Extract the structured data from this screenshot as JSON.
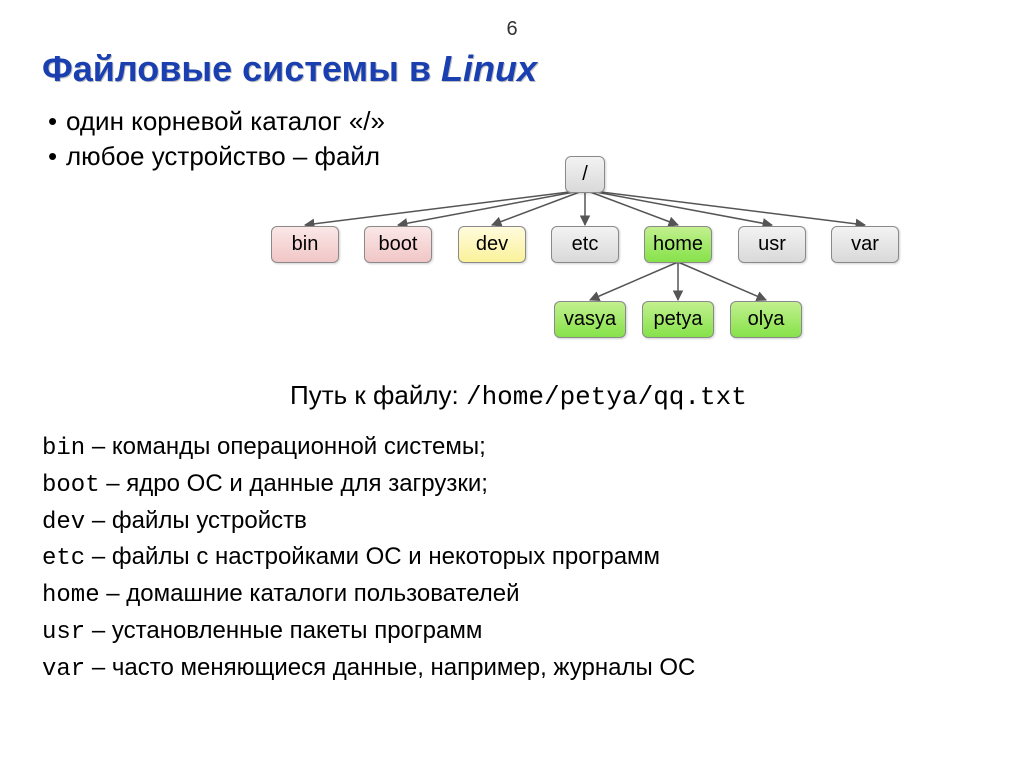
{
  "page_number": "6",
  "title_prefix": "Файловые системы в ",
  "title_italic": "Linux",
  "bullets": [
    "один корневой каталог «/»",
    "любое устройство – файл"
  ],
  "tree": {
    "root": "/",
    "level1": [
      "bin",
      "boot",
      "dev",
      "etc",
      "home",
      "usr",
      "var"
    ],
    "level2": [
      "vasya",
      "petya",
      "olya"
    ]
  },
  "path_label": "Путь к файлу: ",
  "path_value": "/home/petya/qq.txt",
  "defs": [
    {
      "term": "bin",
      "sep": " – ",
      "desc": "команды операционной системы;"
    },
    {
      "term": "boot",
      "sep": " – ",
      "desc": "ядро ОС и данные для загрузки;"
    },
    {
      "term": "dev",
      "sep": " – ",
      "desc": "файлы устройств"
    },
    {
      "term": "etc",
      "sep": " – ",
      "desc": "файлы с настройками ОС и некоторых программ"
    },
    {
      "term": "home",
      "sep": " – ",
      "desc": "домашние каталоги пользователей"
    },
    {
      "term": "usr",
      "sep": " – ",
      "desc": "установленные пакеты программ"
    },
    {
      "term": "var",
      "sep": " – ",
      "desc": "часто меняющиеся данные,  например, журналы ОС"
    }
  ]
}
